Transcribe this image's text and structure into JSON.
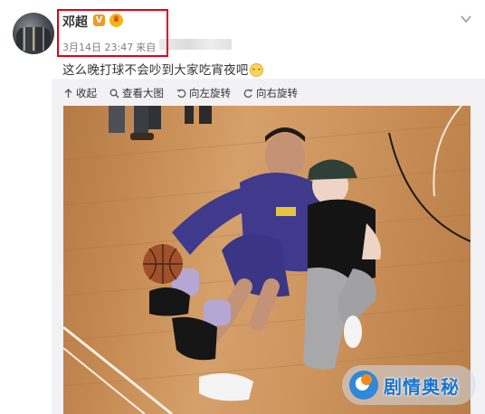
{
  "post": {
    "author": "邓超",
    "vip_badge": "V",
    "crown_badge": "♛",
    "timestamp": "3月14日 23:47",
    "source_prefix": "来自",
    "text": "这么晚打球不会吵到大家吃宵夜吧"
  },
  "toolbar": {
    "collapse": "收起",
    "view_large": "查看大图",
    "rotate_left": "向左旋转",
    "rotate_right": "向右旋转"
  },
  "watermark": {
    "text": "剧情奥秘"
  },
  "colors": {
    "highlight": "#e60012",
    "watermark": "#1d73cc",
    "badge": "#f19a1f"
  },
  "icons": [
    "collapse-icon",
    "magnifier-icon",
    "rotate-left-icon",
    "rotate-right-icon",
    "chevron-down-icon",
    "emoji-icon"
  ]
}
